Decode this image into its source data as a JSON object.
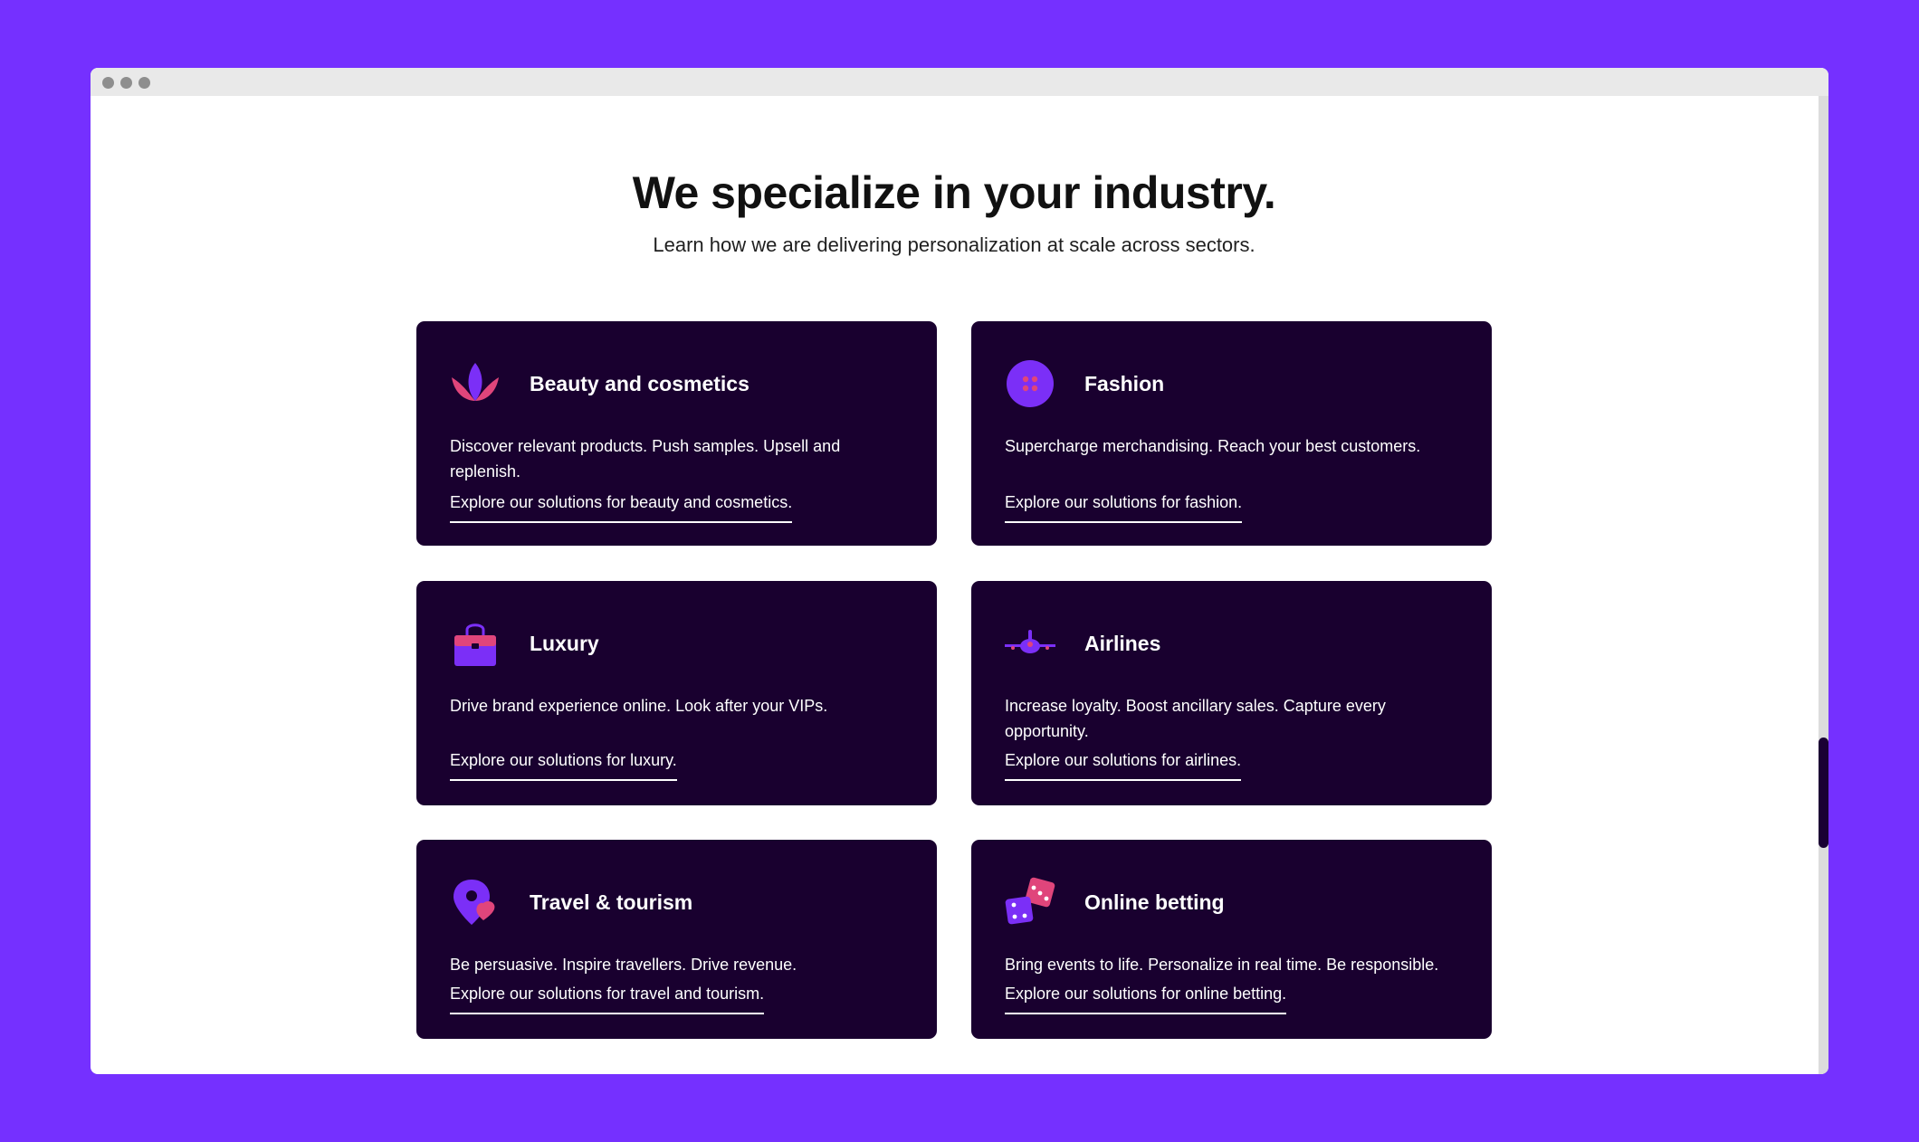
{
  "colors": {
    "background": "#7530ff",
    "card": "#19002f",
    "accent_purple": "#7b2ff7",
    "accent_pink": "#e0457b"
  },
  "section": {
    "heading": "We specialize in your industry.",
    "subheading": "Learn how we are delivering personalization at scale across sectors."
  },
  "cards": [
    {
      "icon": "lotus-icon",
      "title": "Beauty and cosmetics",
      "description": "Discover relevant products. Push samples. Upsell and replenish.",
      "link": "Explore our solutions for beauty and cosmetics."
    },
    {
      "icon": "button-icon",
      "title": "Fashion",
      "description": "Supercharge merchandising. Reach your best customers.",
      "link": "Explore our solutions for fashion."
    },
    {
      "icon": "handbag-icon",
      "title": "Luxury",
      "description": "Drive brand experience online. Look after your VIPs.",
      "link": "Explore our solutions for luxury."
    },
    {
      "icon": "airplane-icon",
      "title": "Airlines",
      "description": "Increase loyalty. Boost ancillary sales. Capture every opportunity.",
      "link": "Explore our solutions for airlines."
    },
    {
      "icon": "map-pin-icon",
      "title": "Travel & tourism",
      "description": "Be persuasive. Inspire travellers. Drive revenue.",
      "link": "Explore our solutions for travel and tourism."
    },
    {
      "icon": "dice-icon",
      "title": "Online betting",
      "description": "Bring events to life. Personalize in real time. Be responsible.",
      "link": "Explore our solutions for online betting."
    }
  ]
}
